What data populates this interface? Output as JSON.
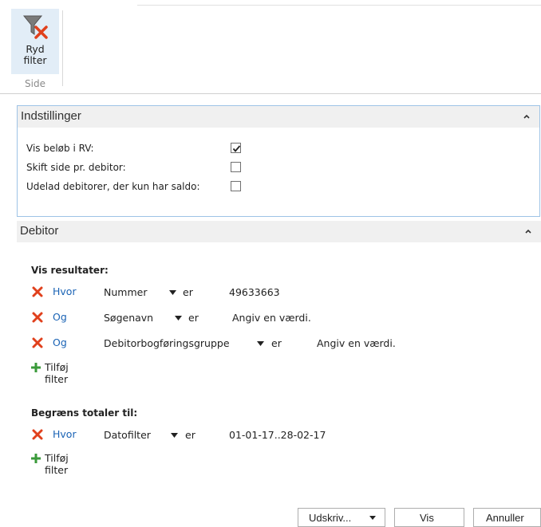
{
  "ribbon": {
    "clear_filter_label_line1": "Ryd",
    "clear_filter_label_line2": "filter",
    "group_label": "Side"
  },
  "settings": {
    "title": "Indstillinger",
    "rows": [
      {
        "label": "Vis beløb i RV:",
        "checked": true
      },
      {
        "label": "Skift side pr. debitor:",
        "checked": false
      },
      {
        "label": "Udelad debitorer, der kun har saldo:",
        "checked": false
      }
    ]
  },
  "debitor": {
    "title": "Debitor",
    "results_title": "Vis resultater:",
    "filters": [
      {
        "keyword": "Hvor",
        "field": "Nummer",
        "operator": "er",
        "value": "49633663"
      },
      {
        "keyword": "Og",
        "field": "Søgenavn",
        "operator": "er",
        "value": "Angiv en værdi."
      },
      {
        "keyword": "Og",
        "field": "Debitorbogføringsgruppe",
        "operator": "er",
        "value": "Angiv en værdi."
      }
    ],
    "add_filter_label": "Tilføj filter",
    "totals_title": "Begræns totaler til:",
    "totals_filters": [
      {
        "keyword": "Hvor",
        "field": "Datofilter",
        "operator": "er",
        "value": "01-01-17..28-02-17"
      }
    ],
    "add_filter_label_2": "Tilføj filter"
  },
  "buttons": {
    "print": "Udskriv...",
    "preview": "Vis",
    "cancel": "Annuller"
  },
  "colors": {
    "accent_blue": "#1a63b5",
    "remove_red": "#e0401c",
    "add_green": "#3a9a3a",
    "ribbon_highlight": "#e2edf7",
    "panel_border": "#9ec3e6"
  }
}
